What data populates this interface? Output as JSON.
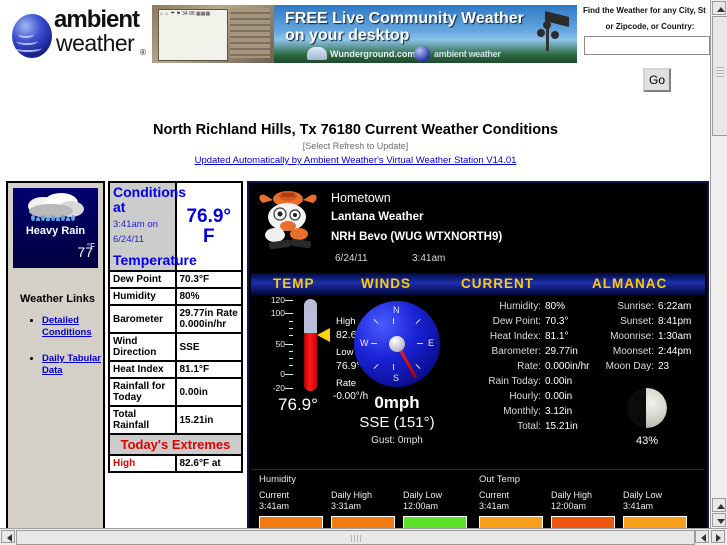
{
  "brand": {
    "name_line1": "ambient",
    "name_line2": "weather",
    "registered": "®"
  },
  "ad": {
    "headline_line1": "FREE Live Community Weather",
    "headline_line2": "on your desktop",
    "partner1": "Wunderground.com",
    "partner2": "ambient weather",
    "device_screen_text": "⌂ ☼ ☂ ⚑ 34 88 ▦▦▦"
  },
  "search": {
    "label_line1": "Find the Weather for any City, St",
    "label_line2": "or Zipcode, or Country:",
    "value": "",
    "placeholder": "",
    "go_label": "Go"
  },
  "page": {
    "title": "North Richland Hills, Tx 76180 Current Weather Conditions",
    "subtitle": "[Select Refresh to Update]",
    "update_link": "Updated Automatically by Ambient Weather's Virtual Weather Station  V14.01"
  },
  "sidebar": {
    "icon": {
      "condition": "Heavy Rain",
      "temp": "77",
      "deg": "°F",
      "icon_name": "heavy-rain-icon"
    },
    "links_title": "Weather Links",
    "links": [
      {
        "label": "Detailed Conditions"
      },
      {
        "label": "Daily Tabular Data"
      }
    ]
  },
  "conditions_table": {
    "header_title": "Conditions at",
    "header_sub": "3:41am on 6/24/11",
    "header_row_label": "Temperature",
    "header_value": "76.9° F",
    "rows": [
      {
        "label": "Dew Point",
        "value": "70.3°F"
      },
      {
        "label": "Humidity",
        "value": "80%"
      },
      {
        "label": "Barometer",
        "value": "29.77in Rate 0.000in/hr"
      },
      {
        "label": "Wind Direction",
        "value": "SSE"
      },
      {
        "label": "Heat Index",
        "value": "81.1°F"
      },
      {
        "label": "Rainfall for Today",
        "value": "0.00in"
      },
      {
        "label": "Total Rainfall",
        "value": "15.21in"
      }
    ],
    "extremes_title": "Today's Extremes",
    "extremes_rows": [
      {
        "label": "High",
        "value": "82.6°F at"
      }
    ]
  },
  "panel": {
    "mascot_name": "bevo-longhorn-mascot-icon",
    "hometown": "Hometown",
    "station_name": "Lantana Weather",
    "station_id": "NRH Bevo (WUG WTXNORTH9)",
    "date": "6/24/11",
    "time": "3:41am",
    "columns": {
      "temp": "TEMP",
      "winds": "WINDS",
      "current": "CURRENT",
      "almanac": "ALMANAC"
    },
    "thermometer": {
      "scale_labels": [
        "120",
        "100",
        "50",
        "0",
        "-20"
      ],
      "high_label": "High",
      "high_value": "82.6°",
      "low_label": "Low",
      "low_value": "76.9°",
      "rate_label": "Rate",
      "rate_value": "-0.00°/h",
      "current": "76.9°"
    },
    "compass": {
      "n": "N",
      "e": "E",
      "s": "S",
      "w": "W",
      "speed": "0mph",
      "direction": "SSE (151°)",
      "gust": "Gust: 0mph"
    },
    "current": [
      {
        "key": "Humidity:",
        "value": "80%"
      },
      {
        "key": "Dew Point:",
        "value": "70.3°"
      },
      {
        "key": "Heat Index:",
        "value": "81.1°"
      },
      {
        "key": "Barometer:",
        "value": "29.77in"
      },
      {
        "key": "Rate:",
        "value": "0.000in/hr"
      },
      {
        "key": "Rain Today:",
        "value": "0.00in"
      },
      {
        "key": "Hourly:",
        "value": "0.00in"
      },
      {
        "key": "Monthly:",
        "value": "3.12in"
      },
      {
        "key": "Total:",
        "value": "15.21in"
      }
    ],
    "almanac": [
      {
        "key": "Sunrise:",
        "value": "6:22am"
      },
      {
        "key": "Sunset:",
        "value": "8:41pm"
      },
      {
        "key": "Moonrise:",
        "value": "1:30am"
      },
      {
        "key": "Moonset:",
        "value": "2:44pm"
      },
      {
        "key": "Moon Day:",
        "value": "23"
      }
    ],
    "moon_phase_pct": "43%"
  },
  "graph_strip": {
    "groups": [
      {
        "title": "Humidity"
      },
      {
        "title": "Out Temp"
      }
    ],
    "columns": [
      {
        "label": "Current",
        "time": "3:41am",
        "color": "#f07b12"
      },
      {
        "label": "Daily High",
        "time": "3:31am",
        "color": "#f07b12"
      },
      {
        "label": "Daily Low",
        "time": "12:00am",
        "color": "#5ee02a"
      },
      {
        "label": "Current",
        "time": "3:41am",
        "color": "#f9a01b"
      },
      {
        "label": "Daily High",
        "time": "12:00am",
        "color": "#ef5411"
      },
      {
        "label": "Daily Low",
        "time": "3:41am",
        "color": "#f9a01b"
      }
    ]
  },
  "colors": {
    "accent_blue": "#0000cc",
    "header_bar": "#1e2fae",
    "header_text": "#ffcc00",
    "extremes_red": "#dd0000",
    "panel_bg": "#000000"
  }
}
